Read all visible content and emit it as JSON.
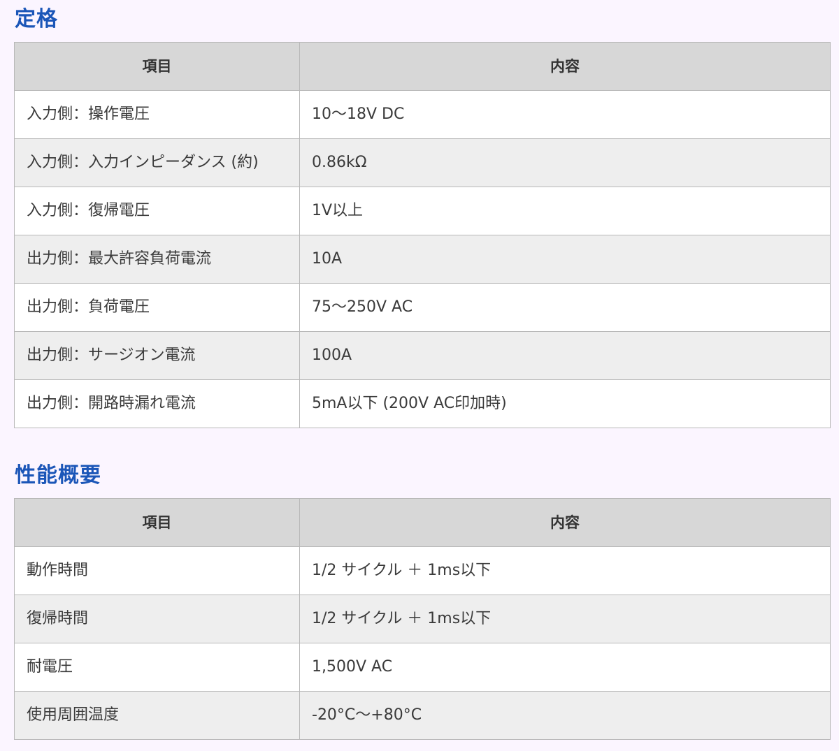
{
  "sections": {
    "ratings": {
      "title": "定格",
      "header": {
        "item": "項目",
        "content": "内容"
      },
      "rows": [
        {
          "item": "入力側：操作電圧",
          "content": "10～18V DC"
        },
        {
          "item": "入力側：入力インピーダンス (約)",
          "content": "0.86kΩ"
        },
        {
          "item": "入力側：復帰電圧",
          "content": "1V以上"
        },
        {
          "item": "出力側：最大許容負荷電流",
          "content": "10A"
        },
        {
          "item": "出力側：負荷電圧",
          "content": "75～250V AC"
        },
        {
          "item": "出力側：サージオン電流",
          "content": "100A"
        },
        {
          "item": "出力側：開路時漏れ電流",
          "content": "5mA以下 (200V AC印加時)"
        }
      ]
    },
    "performance": {
      "title": "性能概要",
      "header": {
        "item": "項目",
        "content": "内容"
      },
      "rows": [
        {
          "item": "動作時間",
          "content": "1/2 サイクル ＋ 1ms以下"
        },
        {
          "item": "復帰時間",
          "content": "1/2 サイクル ＋ 1ms以下"
        },
        {
          "item": "耐電圧",
          "content": "1,500V AC"
        },
        {
          "item": "使用周囲温度",
          "content": "-20°C～+80°C"
        }
      ]
    }
  },
  "colors": {
    "heading": "#1b56b8",
    "page_background": "#fbf5ff",
    "table_header_background": "#d7d7d7",
    "row_alt_background": "#eeeeee",
    "border": "#b8b8b8"
  }
}
